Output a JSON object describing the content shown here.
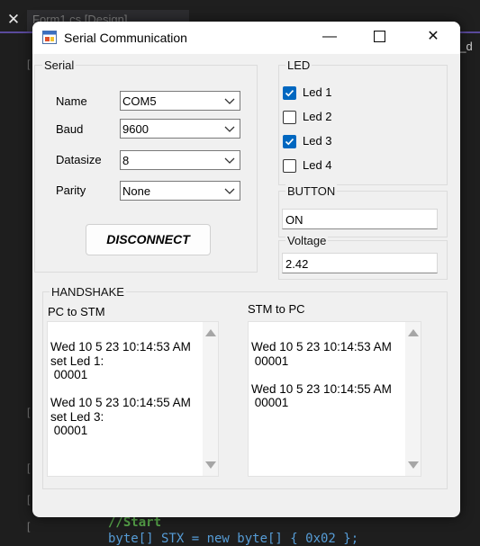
{
  "ide": {
    "close_glyph": "✕",
    "tab_label": "Form1.cs [Design]",
    "right_text": "e_d",
    "gutter_marks": [
      "[",
      "[",
      "[",
      "[",
      "["
    ],
    "code_line1": "//Start",
    "code_line2": "byte[] STX = new byte[] { 0x02 };"
  },
  "window": {
    "title": "Serial Communication",
    "minimize_glyph": "—",
    "maximize_glyph": "☐",
    "close_glyph": "✕"
  },
  "serial": {
    "label": "Serial",
    "fields": [
      {
        "label": "Name",
        "value": "COM5"
      },
      {
        "label": "Baud",
        "value": "9600"
      },
      {
        "label": "Datasize",
        "value": "8"
      },
      {
        "label": "Parity",
        "value": "None"
      }
    ],
    "disconnect_label": "DISCONNECT"
  },
  "led": {
    "label": "LED",
    "items": [
      {
        "label": "Led 1",
        "checked": true
      },
      {
        "label": "Led 2",
        "checked": false
      },
      {
        "label": "Led 3",
        "checked": true
      },
      {
        "label": "Led 4",
        "checked": false
      }
    ]
  },
  "button_group": {
    "label": "BUTTON",
    "value": "ON"
  },
  "voltage": {
    "label": "Voltage",
    "value": "2.42"
  },
  "handshake": {
    "label": "HANDSHAKE",
    "pc_to_stm": {
      "label": "PC to STM",
      "text": "Wed 10 5 23 10:14:53 AM\nset Led 1:\n \u000700001\u0003\n\nWed 10 5 23 10:14:55 AM\nset Led 3:\n \u000700001\u0003"
    },
    "stm_to_pc": {
      "label": "STM to PC",
      "text": "Wed 10 5 23 10:14:53 AM\n \u000700001\u0003\n\nWed 10 5 23 10:14:55 AM\n \u000700001\u0003"
    }
  },
  "colors": {
    "accent": "#0067c0",
    "ide_background": "#1e1e1e"
  }
}
